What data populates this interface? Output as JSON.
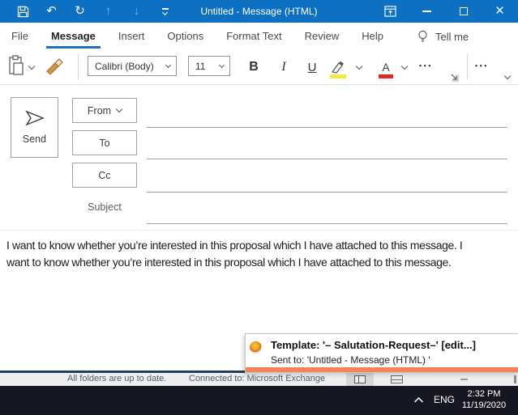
{
  "window": {
    "title": "Untitled  -  Message (HTML)"
  },
  "icons": {
    "undo": "↶",
    "redo": "↻",
    "up": "↑",
    "down": "↓",
    "close": "×",
    "dots": "•••"
  },
  "menubar": {
    "items": [
      "File",
      "Message",
      "Insert",
      "Options",
      "Format Text",
      "Review",
      "Help"
    ],
    "active_item": "Message",
    "tell_me": "Tell me"
  },
  "ribbon": {
    "font_name": "Calibri (Body)",
    "font_size": "11",
    "bold": "B",
    "italic": "I",
    "underline": "U",
    "font_color_letter": "A",
    "highlight_color": "#f3e93c",
    "font_color": "#e02b20"
  },
  "compose": {
    "send_label": "Send",
    "from_label": "From",
    "to_label": "To",
    "cc_label": "Cc",
    "subject_label": "Subject",
    "body_line1": "I want to know whether you’re interested in this proposal which I have attached to this message. I",
    "body_line2": "want to know whether you’re interested in this proposal which I have attached to this message."
  },
  "popup": {
    "title": "Template: '– Salutation-Request–' [edit...]",
    "subtitle": "Sent to: 'Untitled - Message (HTML) '",
    "accent_color": "#f4835c"
  },
  "statusbar": {
    "folders_status": "All folders are up to date.",
    "connection_status": "Connected to: Microsoft Exchange"
  },
  "taskbar": {
    "language": "ENG",
    "time": "2:32 PM",
    "date": "11/19/2020"
  }
}
